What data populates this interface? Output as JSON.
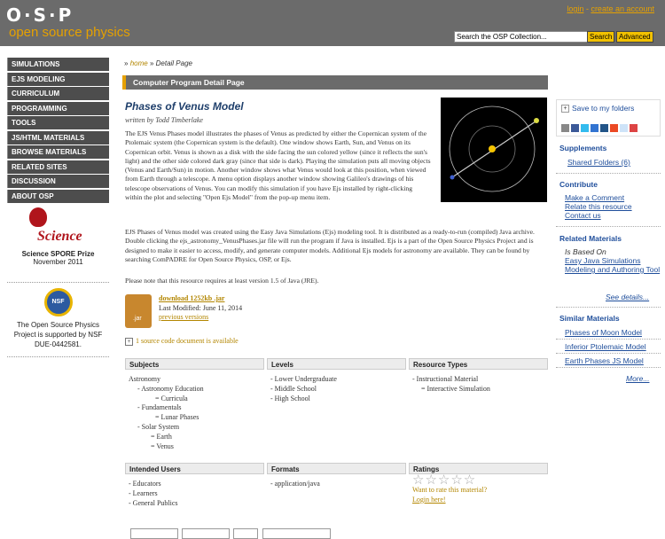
{
  "header": {
    "logo_text": "O·S·P",
    "logo_tagline": "open source physics",
    "login": "login",
    "separator": " - ",
    "create_account": "create an account",
    "search_placeholder": "Search the OSP Collection...",
    "search_button": "Search",
    "advanced_button": "Advanced"
  },
  "nav": {
    "items": [
      "SIMULATIONS",
      "EJS MODELING",
      "CURRICULUM",
      "PROGRAMMING",
      "TOOLS",
      "JS/HTML MATERIALS",
      "BROWSE MATERIALS",
      "RELATED SITES",
      "DISCUSSION",
      "ABOUT OSP"
    ]
  },
  "science": {
    "logo_word": "Science",
    "prize": "Science SPORE Prize",
    "date": "November 2011"
  },
  "nsf": {
    "logo_text": "NSF",
    "line1": "The Open Source Physics",
    "line2": "Project is supported by NSF",
    "line3": "DUE-0442581."
  },
  "breadcrumb": {
    "sep": "»",
    "home": "home",
    "current": "Detail Page"
  },
  "banner": "Computer Program Detail Page",
  "resource": {
    "title": "Phases of Venus Model",
    "author": "written by Todd Timberlake",
    "desc1": "The EJS Venus Phases model illustrates the phases of Venus as predicted by either the Copernican system of the Ptolemaic system (the Copernican system is the default). One window shows Earth, Sun, and Venus on its Copernican orbit. Venus is shown as a disk with the side facing the sun colored yellow (since it reflects the sun's light) and the other side colored dark gray (since that side is dark). Playing the simulation puts all moving objects (Venus and Earth/Sun) in motion. Another window shows what Venus would look at this position, when viewed from Earth through a telescope. A menu option displays another window showing Galileo's drawings of his telescope observations of Venus.  You can modify this simulation if you have Ejs installed by right-clicking within the plot and selecting \"Open Ejs Model\" from the pop-up menu item.",
    "desc2": "EJS Phases of Venus model was created using the Easy Java Simulations  (Ejs) modeling tool.  It is distributed as a ready-to-run (compiled) Java archive.   Double clicking the ejs_astronomy_VenusPhases.jar file will run the program if  Java is installed.  Ejs is a part of the Open Source Physics Project and is designed to make it easier to access, modify, and generate computer models.  Additional Ejs models for astronomy are available.  They can be found by searching ComPADRE for  Open Source Physics, OSP, or Ejs.",
    "desc3": "Please note that this resource requires at least version 1.5 of Java (JRE).",
    "download_label": "download 1252kb .jar",
    "jar_label": ".jar",
    "last_modified": "Last Modified: June 11, 2014",
    "previous_versions": "previous versions",
    "source_docs": "1 source code document is available"
  },
  "tables": {
    "subjects_header": "Subjects",
    "levels_header": "Levels",
    "types_header": "Resource Types",
    "subjects": [
      "Astronomy",
      "- Astronomy Education",
      "= Curricula",
      "- Fundamentals",
      "= Lunar Phases",
      "- Solar System",
      "= Earth",
      "= Venus"
    ],
    "levels": [
      "- Lower Undergraduate",
      "- Middle School",
      "- High School"
    ],
    "types": [
      "- Instructional Material",
      "= Interactive Simulation"
    ],
    "intended_header": "Intended Users",
    "formats_header": "Formats",
    "ratings_header": "Ratings",
    "intended": [
      "- Educators",
      "- Learners",
      "- General Publics"
    ],
    "formats": [
      "- application/java"
    ],
    "rating_stars": "☆☆☆☆☆",
    "rate_prompt": "Want to rate this material?",
    "login_here": "Login here!"
  },
  "sidebar": {
    "save": "Save to my folders",
    "share_icons": [
      "share-icon",
      "facebook-icon",
      "twitter-icon",
      "delicious-icon",
      "digg-icon",
      "stumbleupon-icon",
      "reddit-icon",
      "google-icon"
    ],
    "supplements_header": "Supplements",
    "shared_folders": "Shared Folders (6)",
    "contribute_header": "Contribute",
    "make_comment": "Make a Comment",
    "relate": "Relate this resource",
    "contact": "Contact us",
    "related_header": "Related Materials",
    "is_based_on": "Is Based On",
    "based_link": "Easy Java Simulations Modeling and Authoring Tool",
    "see_details": "See details...",
    "similar_header": "Similar Materials",
    "similar": [
      "Phases of Moon Model",
      "Inferior Ptolemaic Model",
      "Earth Phases JS Model"
    ],
    "more": "More..."
  },
  "colors": {
    "header_bg": "#6b6b6b",
    "accent": "#e6a100",
    "nav_bg": "#4d4d4d",
    "link_blue": "#1f4e9b"
  }
}
